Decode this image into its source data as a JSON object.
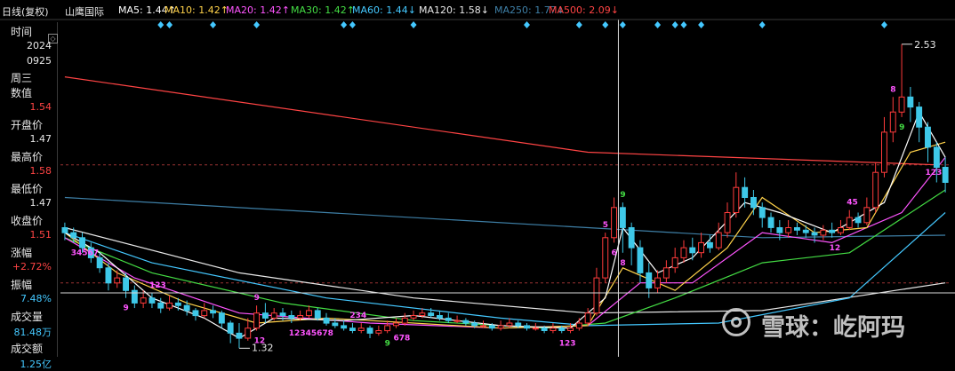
{
  "header": {
    "period": "日线(复权)",
    "name": "山鹰国际",
    "mas": [
      {
        "label": "MA5: 1.44",
        "arrow": "↑",
        "color": "#ffffff"
      },
      {
        "label": "MA10: 1.42",
        "arrow": "↑",
        "color": "#ffd24a"
      },
      {
        "label": "MA20: 1.42",
        "arrow": "↑",
        "color": "#ff55ff"
      },
      {
        "label": "MA30: 1.42",
        "arrow": "↑",
        "color": "#44dd44"
      },
      {
        "label": "MA60: 1.44",
        "arrow": "↓",
        "color": "#44c8ff"
      },
      {
        "label": "MA120: 1.58",
        "arrow": "↓",
        "color": "#e8e8e8"
      },
      {
        "label": "MA250: 1.77",
        "arrow": "↓",
        "color": "#3e7fa6"
      },
      {
        "label": "MA500: 2.09",
        "arrow": "↓",
        "color": "#ff4444"
      }
    ]
  },
  "sidebar": {
    "icon": "collapse-icon",
    "items": [
      {
        "label": "时间",
        "values": [
          "2024",
          "0925",
          "周三"
        ]
      },
      {
        "label": "数值",
        "values": [
          "1.54"
        ],
        "vcolor": "#ff4444"
      },
      {
        "label": "开盘价",
        "values": [
          "1.47"
        ]
      },
      {
        "label": "最高价",
        "values": [
          "1.58"
        ],
        "vcolor": "#ff4444"
      },
      {
        "label": "最低价",
        "values": [
          "1.47"
        ]
      },
      {
        "label": "收盘价",
        "values": [
          "1.51"
        ],
        "vcolor": "#ff4444"
      },
      {
        "label": "涨幅",
        "values": [
          "+2.72%"
        ],
        "vcolor": "#ff4444"
      },
      {
        "label": "振幅",
        "values": [
          "7.48%"
        ],
        "vcolor": "#44c8ff"
      },
      {
        "label": "成交量",
        "values": [
          "81.48万"
        ],
        "vcolor": "#44c8ff"
      },
      {
        "label": "成交额",
        "values": [
          "1.25亿"
        ],
        "vcolor": "#44c8ff"
      }
    ]
  },
  "chart_data": {
    "type": "candlestick",
    "ylim": [
      1.3,
      2.6
    ],
    "price_markers": {
      "high": "2.53",
      "low": "1.32"
    },
    "cursor_level": "1.54",
    "colors": {
      "up": "#ff3b3b",
      "down": "#3ec8e8",
      "ma500": "#ff4444",
      "ma250": "#3e7fa6",
      "ma120": "#e8e8e8",
      "ma60": "#44c8ff",
      "ma30": "#44dd44",
      "ma20": "#ff55ff",
      "ma10": "#ffd24a",
      "ma5": "#ffffff"
    },
    "candles": [
      [
        1.8,
        1.78,
        1.82,
        1.75
      ],
      [
        1.78,
        1.76,
        1.8,
        1.74
      ],
      [
        1.76,
        1.72,
        1.78,
        1.7
      ],
      [
        1.72,
        1.68,
        1.74,
        1.66
      ],
      [
        1.68,
        1.64,
        1.7,
        1.62
      ],
      [
        1.64,
        1.58,
        1.66,
        1.55
      ],
      [
        1.58,
        1.6,
        1.63,
        1.56
      ],
      [
        1.6,
        1.55,
        1.62,
        1.52
      ],
      [
        1.55,
        1.5,
        1.57,
        1.48
      ],
      [
        1.5,
        1.52,
        1.55,
        1.48
      ],
      [
        1.52,
        1.5,
        1.54,
        1.48
      ],
      [
        1.5,
        1.48,
        1.52,
        1.46
      ],
      [
        1.48,
        1.5,
        1.53,
        1.47
      ],
      [
        1.5,
        1.49,
        1.52,
        1.47
      ],
      [
        1.49,
        1.47,
        1.51,
        1.45
      ],
      [
        1.47,
        1.45,
        1.48,
        1.43
      ],
      [
        1.45,
        1.47,
        1.5,
        1.44
      ],
      [
        1.47,
        1.46,
        1.49,
        1.44
      ],
      [
        1.46,
        1.42,
        1.47,
        1.4
      ],
      [
        1.42,
        1.38,
        1.43,
        1.34
      ],
      [
        1.38,
        1.36,
        1.42,
        1.32
      ],
      [
        1.36,
        1.4,
        1.44,
        1.35
      ],
      [
        1.4,
        1.46,
        1.49,
        1.39
      ],
      [
        1.46,
        1.44,
        1.5,
        1.42
      ],
      [
        1.44,
        1.46,
        1.48,
        1.43
      ],
      [
        1.46,
        1.45,
        1.48,
        1.43
      ],
      [
        1.45,
        1.44,
        1.47,
        1.42
      ],
      [
        1.44,
        1.45,
        1.47,
        1.43
      ],
      [
        1.45,
        1.47,
        1.49,
        1.44
      ],
      [
        1.47,
        1.44,
        1.48,
        1.43
      ],
      [
        1.44,
        1.42,
        1.46,
        1.41
      ],
      [
        1.42,
        1.41,
        1.44,
        1.4
      ],
      [
        1.41,
        1.4,
        1.43,
        1.39
      ],
      [
        1.4,
        1.39,
        1.42,
        1.38
      ],
      [
        1.39,
        1.4,
        1.42,
        1.38
      ],
      [
        1.4,
        1.38,
        1.41,
        1.36
      ],
      [
        1.38,
        1.39,
        1.41,
        1.37
      ],
      [
        1.39,
        1.41,
        1.43,
        1.38
      ],
      [
        1.41,
        1.42,
        1.44,
        1.4
      ],
      [
        1.42,
        1.44,
        1.46,
        1.41
      ],
      [
        1.44,
        1.45,
        1.47,
        1.43
      ],
      [
        1.45,
        1.46,
        1.48,
        1.44
      ],
      [
        1.46,
        1.45,
        1.48,
        1.44
      ],
      [
        1.45,
        1.44,
        1.47,
        1.43
      ],
      [
        1.44,
        1.43,
        1.46,
        1.42
      ],
      [
        1.43,
        1.43,
        1.45,
        1.42
      ],
      [
        1.43,
        1.42,
        1.44,
        1.41
      ],
      [
        1.42,
        1.41,
        1.43,
        1.4
      ],
      [
        1.41,
        1.41,
        1.43,
        1.4
      ],
      [
        1.41,
        1.4,
        1.42,
        1.39
      ],
      [
        1.4,
        1.41,
        1.43,
        1.39
      ],
      [
        1.41,
        1.42,
        1.44,
        1.4
      ],
      [
        1.42,
        1.41,
        1.43,
        1.4
      ],
      [
        1.41,
        1.4,
        1.42,
        1.39
      ],
      [
        1.4,
        1.4,
        1.42,
        1.39
      ],
      [
        1.4,
        1.39,
        1.41,
        1.38
      ],
      [
        1.39,
        1.4,
        1.42,
        1.38
      ],
      [
        1.4,
        1.39,
        1.41,
        1.38
      ],
      [
        1.39,
        1.4,
        1.42,
        1.38
      ],
      [
        1.4,
        1.42,
        1.44,
        1.39
      ],
      [
        1.42,
        1.46,
        1.48,
        1.41
      ],
      [
        1.46,
        1.6,
        1.64,
        1.45
      ],
      [
        1.6,
        1.76,
        1.78,
        1.58
      ],
      [
        1.76,
        1.88,
        1.92,
        1.74
      ],
      [
        1.88,
        1.8,
        1.9,
        1.7
      ],
      [
        1.8,
        1.72,
        1.82,
        1.65
      ],
      [
        1.72,
        1.62,
        1.75,
        1.58
      ],
      [
        1.62,
        1.56,
        1.66,
        1.52
      ],
      [
        1.56,
        1.6,
        1.63,
        1.54
      ],
      [
        1.6,
        1.64,
        1.67,
        1.58
      ],
      [
        1.64,
        1.68,
        1.72,
        1.62
      ],
      [
        1.68,
        1.72,
        1.75,
        1.66
      ],
      [
        1.72,
        1.7,
        1.76,
        1.67
      ],
      [
        1.7,
        1.74,
        1.78,
        1.68
      ],
      [
        1.74,
        1.72,
        1.77,
        1.7
      ],
      [
        1.72,
        1.78,
        1.82,
        1.71
      ],
      [
        1.78,
        1.86,
        1.9,
        1.76
      ],
      [
        1.86,
        1.96,
        2.02,
        1.84
      ],
      [
        1.96,
        1.92,
        2.0,
        1.88
      ],
      [
        1.92,
        1.88,
        1.95,
        1.85
      ],
      [
        1.88,
        1.84,
        1.9,
        1.8
      ],
      [
        1.84,
        1.8,
        1.86,
        1.78
      ],
      [
        1.8,
        1.78,
        1.83,
        1.75
      ],
      [
        1.78,
        1.8,
        1.83,
        1.76
      ],
      [
        1.8,
        1.79,
        1.82,
        1.77
      ],
      [
        1.79,
        1.78,
        1.81,
        1.76
      ],
      [
        1.78,
        1.77,
        1.8,
        1.74
      ],
      [
        1.77,
        1.79,
        1.81,
        1.75
      ],
      [
        1.79,
        1.78,
        1.82,
        1.76
      ],
      [
        1.78,
        1.8,
        1.83,
        1.77
      ],
      [
        1.8,
        1.84,
        1.87,
        1.79
      ],
      [
        1.84,
        1.82,
        1.86,
        1.8
      ],
      [
        1.82,
        1.88,
        1.92,
        1.81
      ],
      [
        1.88,
        2.02,
        2.06,
        1.86
      ],
      [
        2.02,
        2.18,
        2.24,
        2.0
      ],
      [
        2.18,
        2.26,
        2.32,
        2.14
      ],
      [
        2.26,
        2.32,
        2.53,
        2.24
      ],
      [
        2.32,
        2.28,
        2.36,
        2.22
      ],
      [
        2.28,
        2.2,
        2.3,
        2.14
      ],
      [
        2.2,
        2.12,
        2.22,
        2.06
      ],
      [
        2.12,
        2.04,
        2.14,
        1.98
      ],
      [
        2.04,
        1.98,
        2.08,
        1.94
      ]
    ],
    "ma_points": {
      "ma500": [
        [
          0,
          2.4
        ],
        [
          60,
          2.1
        ],
        [
          100,
          2.05
        ]
      ],
      "ma250": [
        [
          0,
          1.92
        ],
        [
          60,
          1.8
        ],
        [
          80,
          1.76
        ],
        [
          101,
          1.77
        ]
      ],
      "ma120": [
        [
          0,
          1.8
        ],
        [
          20,
          1.62
        ],
        [
          40,
          1.52
        ],
        [
          60,
          1.46
        ],
        [
          80,
          1.47
        ],
        [
          101,
          1.58
        ]
      ],
      "ma60": [
        [
          0,
          1.78
        ],
        [
          10,
          1.66
        ],
        [
          30,
          1.52
        ],
        [
          50,
          1.44
        ],
        [
          60,
          1.41
        ],
        [
          75,
          1.42
        ],
        [
          90,
          1.52
        ],
        [
          101,
          1.86
        ]
      ],
      "ma30": [
        [
          0,
          1.76
        ],
        [
          10,
          1.62
        ],
        [
          25,
          1.5
        ],
        [
          40,
          1.43
        ],
        [
          55,
          1.4
        ],
        [
          62,
          1.42
        ],
        [
          70,
          1.52
        ],
        [
          80,
          1.66
        ],
        [
          90,
          1.7
        ],
        [
          101,
          1.95
        ]
      ],
      "ma20": [
        [
          0,
          1.76
        ],
        [
          8,
          1.6
        ],
        [
          20,
          1.46
        ],
        [
          35,
          1.42
        ],
        [
          50,
          1.4
        ],
        [
          60,
          1.41
        ],
        [
          66,
          1.58
        ],
        [
          72,
          1.58
        ],
        [
          80,
          1.78
        ],
        [
          88,
          1.74
        ],
        [
          96,
          1.86
        ],
        [
          101,
          2.08
        ]
      ],
      "ma10": [
        [
          0,
          1.78
        ],
        [
          6,
          1.62
        ],
        [
          14,
          1.5
        ],
        [
          22,
          1.42
        ],
        [
          30,
          1.44
        ],
        [
          40,
          1.42
        ],
        [
          50,
          1.4
        ],
        [
          60,
          1.41
        ],
        [
          64,
          1.64
        ],
        [
          70,
          1.55
        ],
        [
          76,
          1.72
        ],
        [
          80,
          1.92
        ],
        [
          86,
          1.78
        ],
        [
          92,
          1.8
        ],
        [
          97,
          2.1
        ],
        [
          101,
          2.14
        ]
      ],
      "ma5": [
        [
          0,
          1.78
        ],
        [
          4,
          1.7
        ],
        [
          10,
          1.52
        ],
        [
          16,
          1.44
        ],
        [
          20,
          1.36
        ],
        [
          24,
          1.44
        ],
        [
          32,
          1.43
        ],
        [
          40,
          1.45
        ],
        [
          50,
          1.41
        ],
        [
          58,
          1.4
        ],
        [
          62,
          1.52
        ],
        [
          64,
          1.8
        ],
        [
          68,
          1.62
        ],
        [
          72,
          1.68
        ],
        [
          78,
          1.9
        ],
        [
          82,
          1.86
        ],
        [
          88,
          1.78
        ],
        [
          94,
          1.9
        ],
        [
          98,
          2.26
        ],
        [
          101,
          2.08
        ]
      ]
    },
    "markers": [
      {
        "i": 64,
        "text": "9",
        "color": "#44dd44"
      },
      {
        "i": 96,
        "text": "9",
        "color": "#44dd44"
      },
      {
        "i": 37,
        "text": "9",
        "color": "#44dd44"
      },
      {
        "i": 22,
        "text": "9",
        "color": "#ff55ff"
      },
      {
        "i": 7,
        "text": "9",
        "color": "#ff55ff"
      },
      {
        "i": 1,
        "text": "34567",
        "color": "#ff55ff"
      },
      {
        "i": 10,
        "text": "123",
        "color": "#ff55ff"
      },
      {
        "i": 22,
        "text": "12",
        "color": "#ff55ff"
      },
      {
        "i": 26,
        "text": "12345678",
        "color": "#ff55ff"
      },
      {
        "i": 33,
        "text": "234",
        "color": "#ff55ff"
      },
      {
        "i": 38,
        "text": "678",
        "color": "#ff55ff"
      },
      {
        "i": 57,
        "text": "123",
        "color": "#ff55ff"
      },
      {
        "i": 62,
        "text": "5",
        "color": "#ff55ff"
      },
      {
        "i": 63,
        "text": "6",
        "color": "#ff55ff"
      },
      {
        "i": 64,
        "text": "8",
        "color": "#ff55ff"
      },
      {
        "i": 95,
        "text": "8",
        "color": "#ff55ff"
      },
      {
        "i": 88,
        "text": "12",
        "color": "#ff55ff"
      },
      {
        "i": 99,
        "text": "123",
        "color": "#ff55ff"
      },
      {
        "i": 90,
        "text": "45",
        "color": "#ff55ff"
      }
    ],
    "signals": [
      11,
      12,
      17,
      22,
      32,
      33,
      40,
      53,
      59,
      62,
      64,
      68,
      70,
      71,
      73,
      80,
      94
    ]
  },
  "watermark": {
    "text": "雪球：屹阿玛",
    "icon": "snowball-logo-icon"
  }
}
